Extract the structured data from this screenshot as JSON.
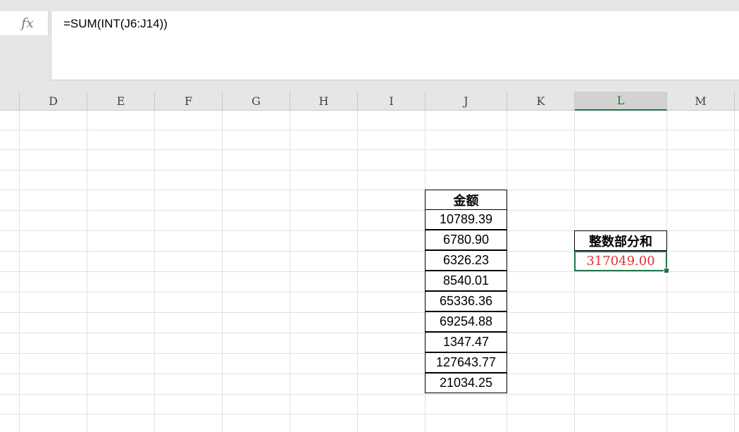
{
  "formula_bar": {
    "fx_label": "fx",
    "formula": "=SUM(INT(J6:J14))"
  },
  "columns": [
    "D",
    "E",
    "F",
    "G",
    "H",
    "I",
    "J",
    "K",
    "L",
    "M"
  ],
  "selected_column": "L",
  "amount_table": {
    "header": "金额",
    "values": [
      "10789.39",
      "6780.90",
      "6326.23",
      "8540.01",
      "65336.36",
      "69254.88",
      "1347.47",
      "127643.77",
      "21034.25"
    ]
  },
  "result": {
    "label": "整数部分和",
    "value": "317049.00",
    "value_color": "#e03030"
  },
  "colors": {
    "selection_green": "#217346"
  }
}
